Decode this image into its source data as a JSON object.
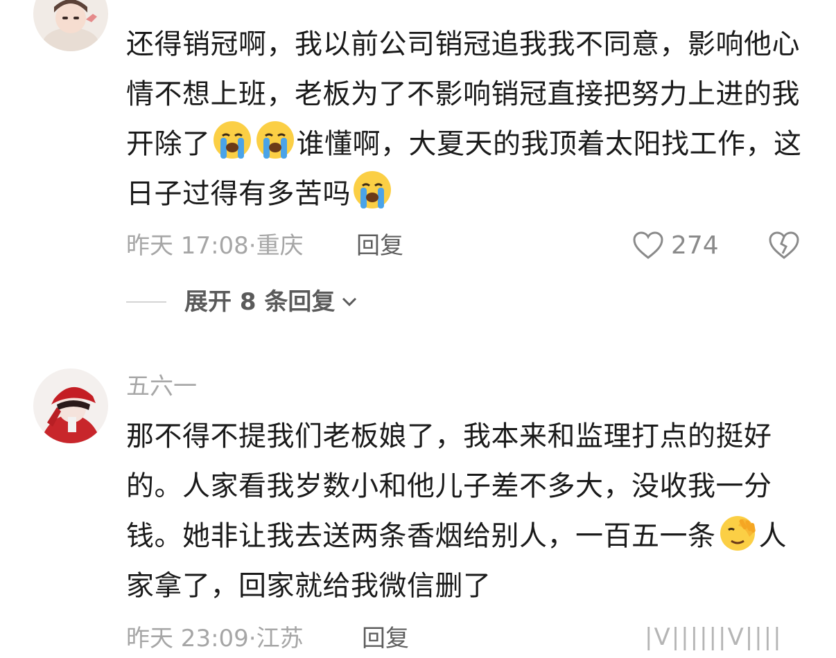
{
  "comments": [
    {
      "text_parts": [
        "还得销冠啊，我以前公司销冠追我我不同意，影响他心情不想上班，老板为了不影响销冠直接把努力上进的我开除了",
        "谁懂啊，大夏天的我顶着太阳找工作，这日子过得有多苦吗"
      ],
      "emoji": [
        "loudly-crying-face",
        "loudly-crying-face",
        "loudly-crying-face"
      ],
      "time": "昨天 17:08",
      "location": "重庆",
      "meta": "昨天 17:08·重庆",
      "reply_label": "回复",
      "likes": "274",
      "expand_label": "展开 8 条回复"
    },
    {
      "username": "五六一",
      "text_parts": [
        "那不得不提我们老板娘了，我本来和监理打点的挺好的。人家看我岁数小和他儿子差不多大，没收我一分钱。她非让我去送两条香烟给别人，一百五一条",
        "人家拿了，回家就给我微信删了"
      ],
      "emoji": [
        "face-palm"
      ],
      "time": "昨天 23:09",
      "location": "江苏",
      "meta": "昨天 23:09·江苏",
      "reply_label": "回复"
    }
  ],
  "watermark": "|V||||||V||||"
}
